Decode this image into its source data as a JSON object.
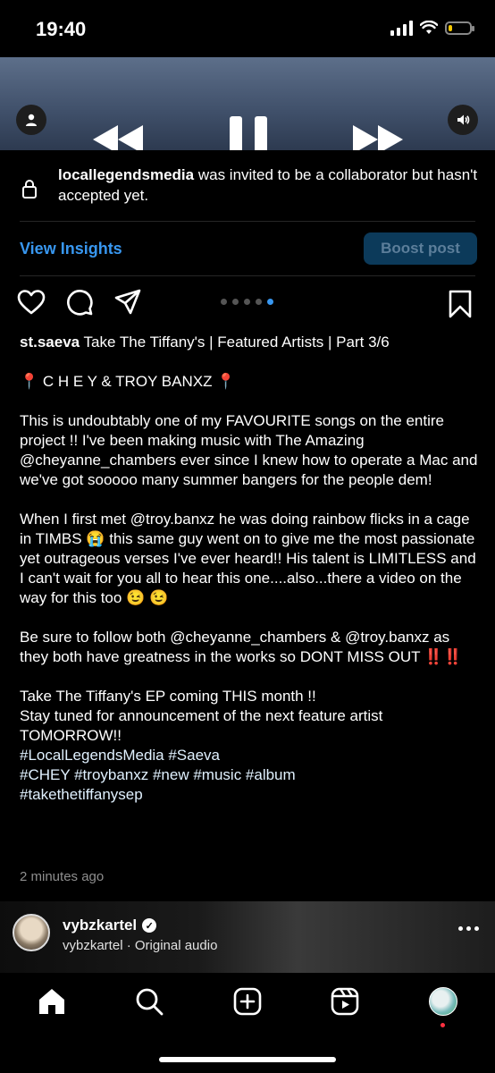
{
  "status": {
    "time": "19:40"
  },
  "collab": {
    "username": "locallegendsmedia",
    "message": " was invited to be a collaborator but hasn't accepted yet."
  },
  "insights": {
    "view_label": "View Insights",
    "boost_label": "Boost post"
  },
  "carousel": {
    "count": 5,
    "active_index": 4
  },
  "caption": {
    "username": "st.saeva",
    "title": " Take The Tiffany's | Featured Artists | Part 3/6",
    "line_pin": "📍 C H E Y & TROY BANXZ 📍",
    "para1": "This is undoubtably one of my FAVOURITE songs on the entire project !! I've been making music with The Amazing @cheyanne_chambers ever since I knew how to operate a Mac and we've got sooooo many summer bangers for the people dem!",
    "para2": "When I first met @troy.banxz he was doing rainbow flicks in a cage in TIMBS 😭 this same guy went on to give me the most passionate yet outrageous verses I've ever heard!! His talent is LIMITLESS and I can't wait for you all to hear this one....also...there a video on the way for this too 😉 😉",
    "para3": "Be sure to follow both @cheyanne_chambers & @troy.banxz as they both have greatness in the works so DONT MISS OUT ‼️‼️",
    "line_ep": "Take The Tiffany's EP coming THIS month !!",
    "line_stay": "Stay tuned for announcement of the next feature artist TOMORROW!!",
    "tags1": "#LocalLegendsMedia #Saeva",
    "tags2": "#CHEY #troybanxz #new #music #album",
    "tags3": "#takethetiffanysep",
    "time_ago": "2 minutes ago"
  },
  "next_post": {
    "username": "vybzkartel",
    "audio": "vybzkartel · Original audio"
  },
  "colors": {
    "accent": "#3897f0",
    "boost_bg": "#0c3a5a",
    "background": "#000000"
  }
}
